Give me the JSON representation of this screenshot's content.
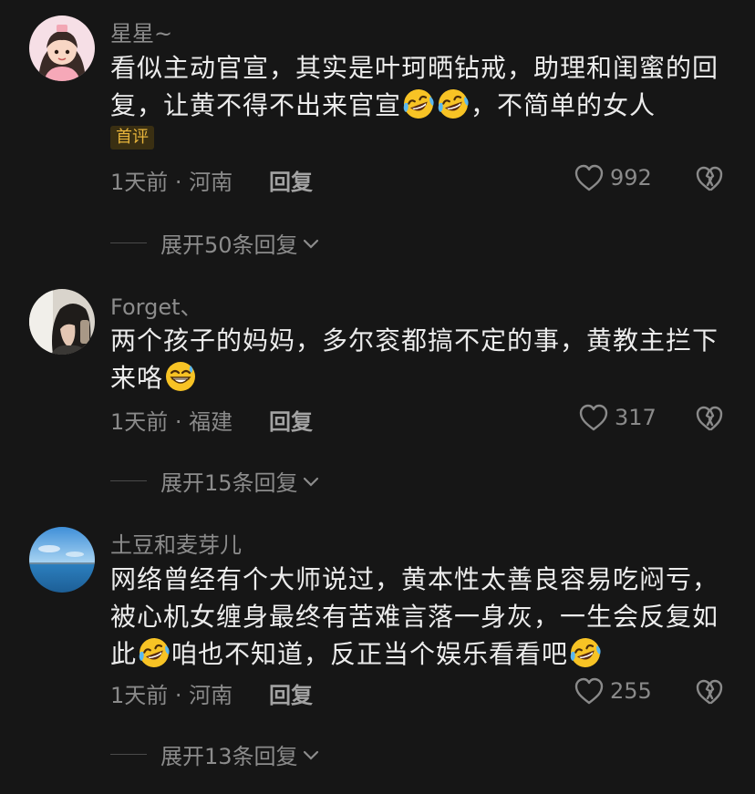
{
  "comments": [
    {
      "username": "星星~",
      "text_parts": [
        "看似主动官宣，其实是叶珂晒钻戒，助理和闺蜜的回复，让黄不得不出来官宣",
        "，不简单的女人"
      ],
      "badge": "首评",
      "meta": "1天前 · 河南",
      "reply": "回复",
      "likes": "992",
      "expand": "展开50条回复"
    },
    {
      "username": "Forget、",
      "text_parts": [
        "两个孩子的妈妈，多尔衮都搞不定的事，黄教主拦下来咯"
      ],
      "meta": "1天前 · 福建",
      "reply": "回复",
      "likes": "317",
      "expand": "展开15条回复"
    },
    {
      "username": "土豆和麦芽儿",
      "text_parts": [
        "网络曾经有个大师说过，黄本性太善良容易吃闷亏，被心机女缠身最终有苦难言落一身灰，一生会反复如此",
        "咱也不知道，反正当个娱乐看看吧"
      ],
      "meta": "1天前 · 河南",
      "reply": "回复",
      "likes": "255",
      "expand": "展开13条回复"
    }
  ],
  "icons": {
    "like": "heart-outline-icon",
    "dislike": "broken-heart-icon",
    "expand": "chevron-down-icon",
    "emoji_laugh": "rofl-emoji",
    "emoji_grin": "grinning-sweat-emoji"
  },
  "colors": {
    "background": "#161616",
    "text": "#ececec",
    "muted": "#8a8a8a",
    "badge_bg": "#3a2f12",
    "badge_text": "#e7b43b"
  }
}
